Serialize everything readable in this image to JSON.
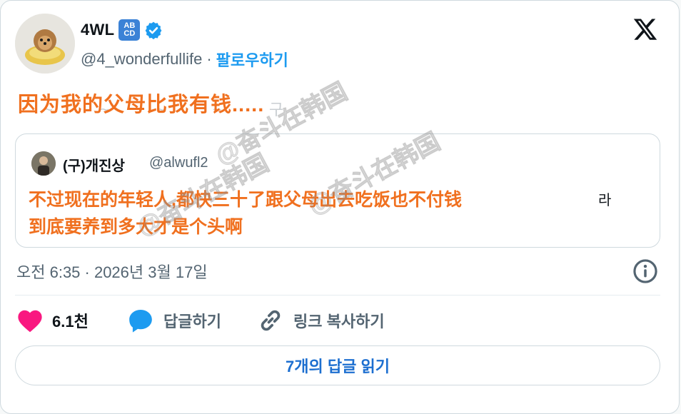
{
  "author": {
    "display_name": "4WL",
    "badge_top": "AB",
    "badge_bottom": "CD",
    "handle": "@4_wonderfullife",
    "separator": "·",
    "follow_label": "팔로우하기"
  },
  "tweet": {
    "overlay_text": "因为我的父母比我有钱.....",
    "faint_text": "~ ~ ~ ~ 구"
  },
  "quoted": {
    "name": "(구)개진상",
    "handle": "@alwufl2",
    "overlay_line1": "不过现在的年轻人,都快三十了跟父母出去吃饭也不付钱",
    "overlay_line2": "到底要养到多大才是个头啊",
    "tail_text": "라"
  },
  "timestamp": "오전 6:35 · 2026년 3월 17일",
  "actions": {
    "like_count": "6.1천",
    "reply_label": "답글하기",
    "copy_link_label": "링크 복사하기"
  },
  "read_replies_label": "7개의 답글 읽기",
  "watermark": "@奋斗在韩国",
  "colors": {
    "accent_blue": "#1d9bf0",
    "overlay_orange": "#f0701f",
    "like_pink": "#f91880"
  }
}
